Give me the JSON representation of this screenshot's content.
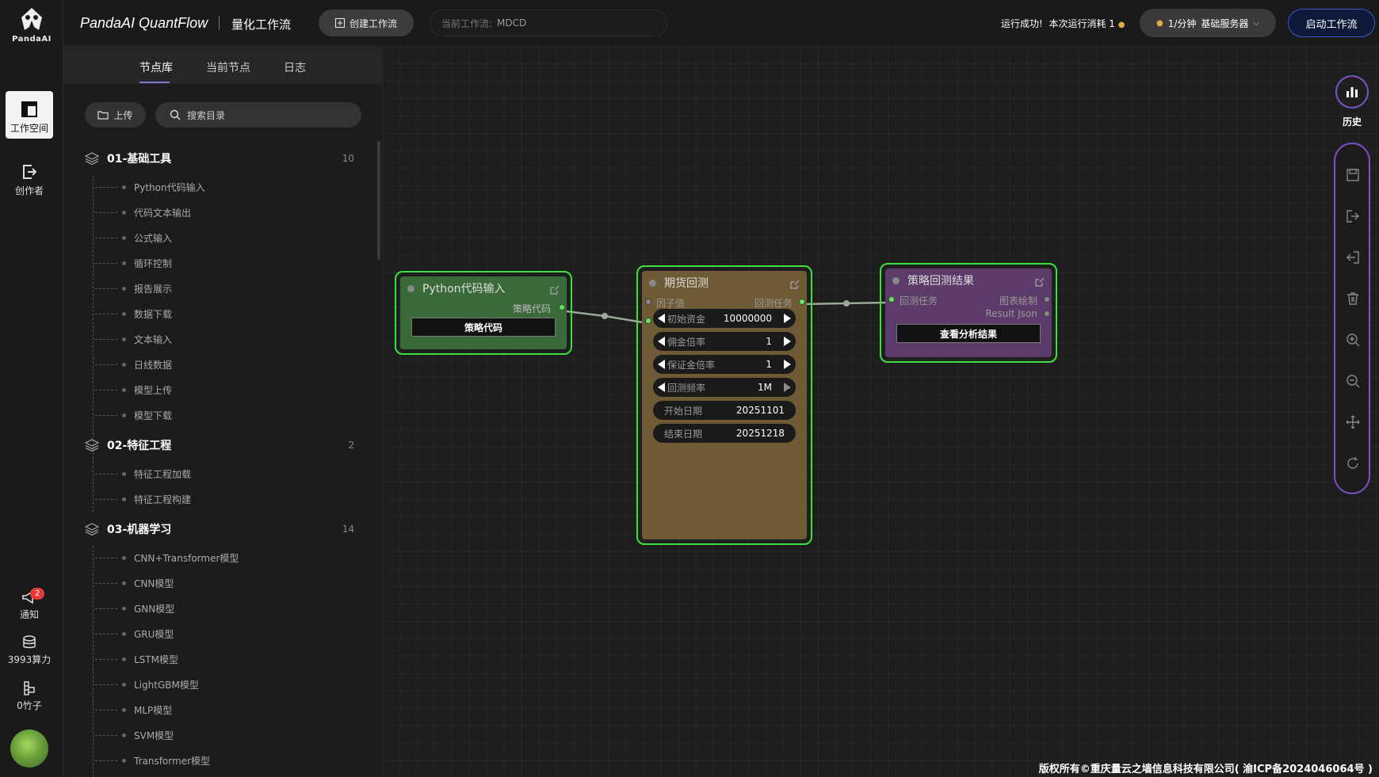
{
  "brand": {
    "logo_text": "PandaAI",
    "title": "PandaAI QuantFlow",
    "subtitle": "量化工作流"
  },
  "rail": {
    "workspace": "工作空间",
    "creator": "创作者",
    "notify": "通知",
    "notify_count": "2",
    "compute": "3993算力",
    "bamboo": "0竹子"
  },
  "topbar": {
    "create_label": "创建工作流",
    "current_flow_label": "当前工作流:",
    "current_flow_name": "MDCD",
    "run_status": "运行成功!",
    "run_cost": "本次运行消耗 1",
    "server_rate": "1/分钟",
    "server_name": "基础服务器",
    "start_label": "启动工作流"
  },
  "sidebar": {
    "tabs": [
      "节点库",
      "当前节点",
      "日志"
    ],
    "upload": "上传",
    "search_placeholder": "搜索目录",
    "groups": [
      {
        "title": "01-基础工具",
        "count": "10",
        "items": [
          "Python代码输入",
          "代码文本输出",
          "公式输入",
          "循环控制",
          "报告展示",
          "数据下载",
          "文本输入",
          "日线数据",
          "模型上传",
          "模型下载"
        ]
      },
      {
        "title": "02-特征工程",
        "count": "2",
        "items": [
          "特征工程加载",
          "特征工程构建"
        ]
      },
      {
        "title": "03-机器学习",
        "count": "14",
        "items": [
          "CNN+Transformer模型",
          "CNN模型",
          "GNN模型",
          "GRU模型",
          "LSTM模型",
          "LightGBM模型",
          "MLP模型",
          "SVM模型",
          "Transformer模型"
        ]
      }
    ]
  },
  "nodes": {
    "python": {
      "title": "Python代码输入",
      "out_label": "策略代码",
      "button": "策略代码",
      "color": "#3a6a3a"
    },
    "futures": {
      "title": "期货回测",
      "in_label": "因子值",
      "out_label": "回测任务",
      "color": "#6e5a34",
      "params": [
        {
          "label": "初始资金",
          "value": "10000000"
        },
        {
          "label": "佣金倍率",
          "value": "1"
        },
        {
          "label": "保证金倍率",
          "value": "1"
        },
        {
          "label": "回测频率",
          "value": "1M"
        },
        {
          "label": "开始日期",
          "value": "20251101"
        },
        {
          "label": "结束日期",
          "value": "20251218"
        }
      ]
    },
    "result": {
      "title": "策略回测结果",
      "in_label": "回测任务",
      "out1": "图表绘制",
      "out2": "Result Json",
      "button": "查看分析结果",
      "color": "#5c3a6a"
    }
  },
  "right_tools": {
    "history": "历史"
  },
  "footer": "版权所有©重庆量云之墙信息科技有限公司( 渝ICP备2024046064号 )"
}
